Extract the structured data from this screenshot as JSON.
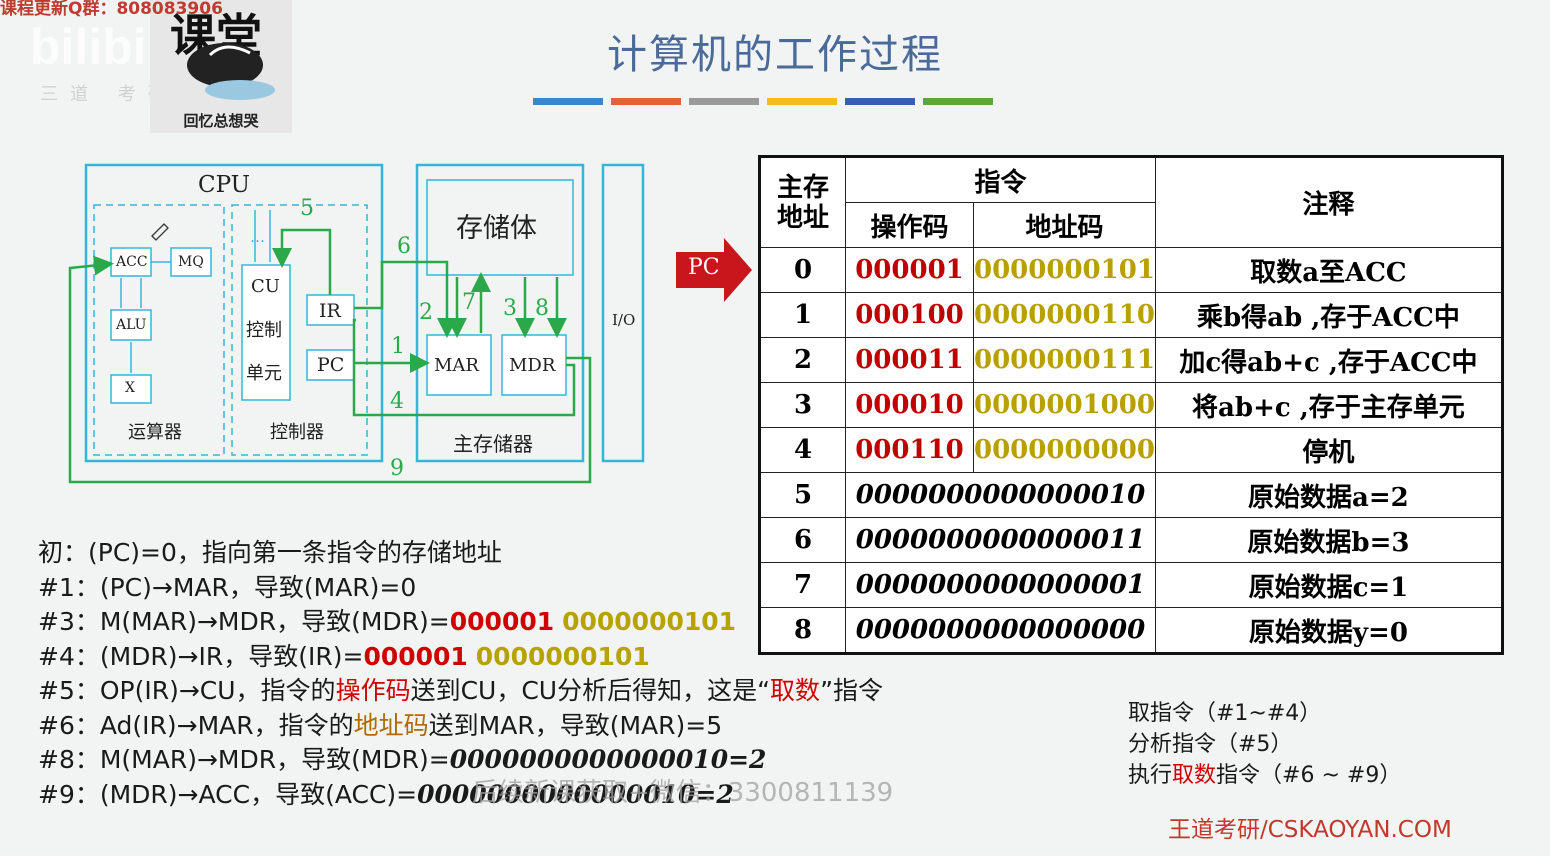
{
  "overlay": {
    "qq_group": "课程更新Q群：808083906",
    "bili": "bilibili",
    "bili_sub": "三道 考研 教育",
    "logo_main": "课堂",
    "logo_caption": "回忆总想哭",
    "bottom_watermark": "后续新课获取+微信：3300811139"
  },
  "title": "计算机的工作过程",
  "title_bar_colors": [
    "#3b87c8",
    "#e0623a",
    "#9a9a9a",
    "#f0bf1a",
    "#3560b0",
    "#5aa63a"
  ],
  "diagram": {
    "cpu": "CPU",
    "acc": "ACC",
    "mq": "MQ",
    "alu": "ALU",
    "x": "X",
    "alu_group": "运算器",
    "cu": "CU",
    "cu_line2": "控制",
    "cu_line3": "单元",
    "ir": "IR",
    "pc": "PC",
    "ctrl_group": "控制器",
    "storage": "存储体",
    "mar": "MAR",
    "mdr": "MDR",
    "mem_group": "主存储器",
    "io": "I/O",
    "n1": "1",
    "n2": "2",
    "n3": "3",
    "n4": "4",
    "n5": "5",
    "n6": "6",
    "n7": "7",
    "n8": "8",
    "n9": "9",
    "dots": "…"
  },
  "pc_pointer": "PC",
  "table": {
    "h_addr": "主存地址",
    "h_addr_l1": "主存",
    "h_addr_l2": "地址",
    "h_instr": "指令",
    "h_op": "操作码",
    "h_ad": "地址码",
    "h_note": "注释",
    "rows": [
      {
        "addr": "0",
        "op": "000001",
        "ad": "0000000101",
        "note": "取数a至ACC"
      },
      {
        "addr": "1",
        "op": "000100",
        "ad": "0000000110",
        "note": "乘b得ab ,存于ACC中"
      },
      {
        "addr": "2",
        "op": "000011",
        "ad": "0000000111",
        "note": "加c得ab+c ,存于ACC中"
      },
      {
        "addr": "3",
        "op": "000010",
        "ad": "0000001000",
        "note": "将ab+c ,存于主存单元"
      },
      {
        "addr": "4",
        "op": "000110",
        "ad": "0000000000",
        "note": "停机"
      },
      {
        "addr": "5",
        "data": "0000000000000010",
        "note": "原始数据a=2"
      },
      {
        "addr": "6",
        "data": "0000000000000011",
        "note": "原始数据b=3"
      },
      {
        "addr": "7",
        "data": "0000000000000001",
        "note": "原始数据c=1"
      },
      {
        "addr": "8",
        "data": "0000000000000000",
        "note": "原始数据y=0"
      }
    ]
  },
  "steps": {
    "s0": "初：(PC)=0，指向第一条指令的存储地址",
    "s1": "#1：(PC)→MAR，导致(MAR)=0",
    "s3_a": "#3：M(MAR)→MDR，导致(MDR)=",
    "s3_op": "000001",
    "s3_ad": "0000000101",
    "s4_a": "#4：(MDR)→IR，导致(IR)=",
    "s4_op": "000001",
    "s4_ad": "0000000101",
    "s5_a": "#5：OP(IR)→CU，指令的",
    "s5_hl": "操作码",
    "s5_b": "送到CU，CU分析后得知，这是“",
    "s5_hl2": "取数",
    "s5_c": "”指令",
    "s6_a": "#6：Ad(IR)→MAR，指令的",
    "s6_hl": "地址码",
    "s6_b": "送到MAR，导致(MAR)=5",
    "s8_a": "#8：M(MAR)→MDR，导致(MDR)=",
    "s8_v": "0000000000000010=2",
    "s9_a": "#9：(MDR)→ACC，导致(ACC)=",
    "s9_v": "0000000000000010=2"
  },
  "summary": {
    "l1": "取指令（#1~#4）",
    "l2": "分析指令（#5）",
    "l3_a": "执行",
    "l3_hl": "取数",
    "l3_b": "指令（#6 ~ #9）"
  },
  "brand": "王道考研/CSKAOYAN.COM"
}
